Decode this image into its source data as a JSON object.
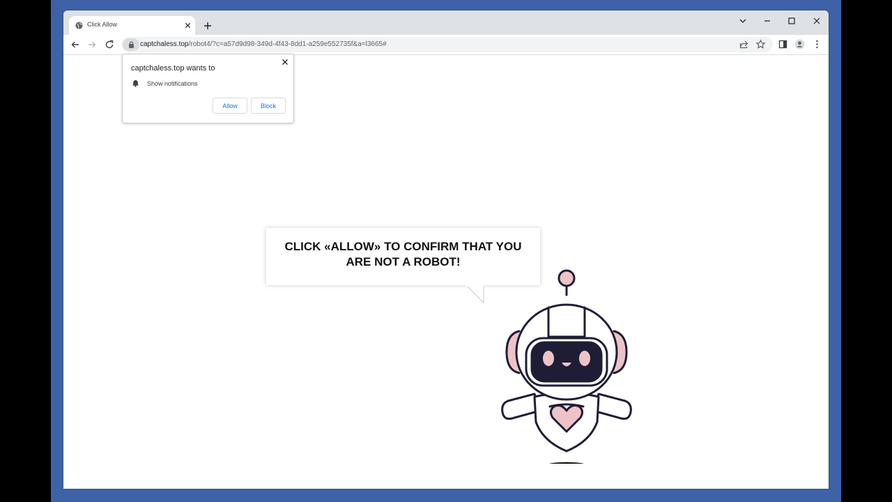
{
  "browser": {
    "tab": {
      "title": "Click Allow"
    },
    "address_bar": {
      "host": "captchaless.top",
      "path": "/robot4/?c=a57d9d98-349d-4f43-8dd1-a259e552735f&a=l3665#"
    }
  },
  "permission_prompt": {
    "heading": "captchaless.top wants to",
    "permission": "Show notifications",
    "allow_label": "Allow",
    "block_label": "Block"
  },
  "page": {
    "message_line1": "CLICK «ALLOW» TO CONFIRM THAT YOU",
    "message_line2": "ARE NOT A ROBOT!"
  },
  "colors": {
    "accent": "#1a73e8",
    "robot_outline": "#1f1d35",
    "robot_pink": "#eec3c8",
    "desktop": "#3d62a8"
  }
}
